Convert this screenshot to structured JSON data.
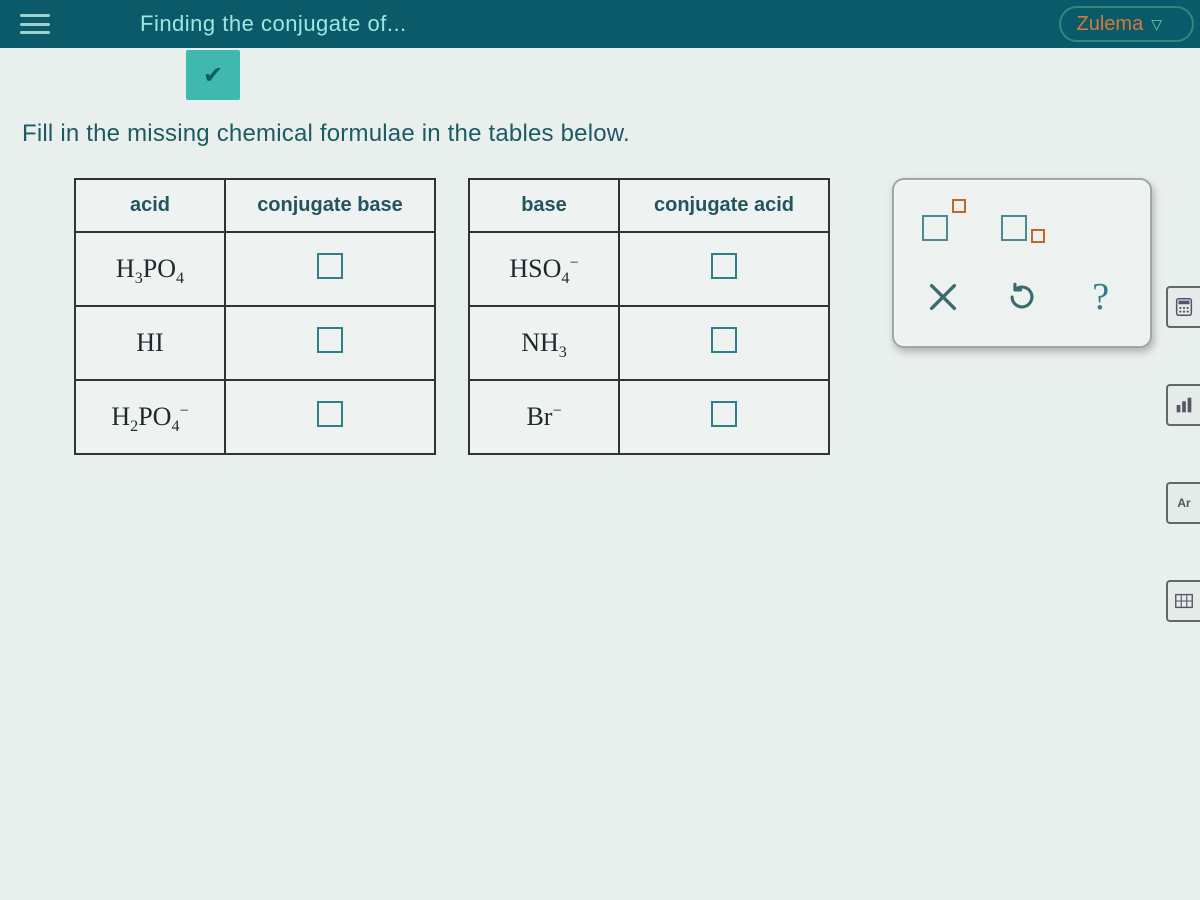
{
  "header": {
    "title": "Finding the conjugate of...",
    "user": "Zulema"
  },
  "instruction": "Fill in the missing chemical formulae in the tables below.",
  "table1": {
    "headers": [
      "acid",
      "conjugate base"
    ],
    "rows": [
      {
        "given_html": "H<sub>3</sub>PO<sub>4</sub>"
      },
      {
        "given_html": "HI"
      },
      {
        "given_html": "H<sub>2</sub>PO<sub>4</sub><sup>−</sup>"
      }
    ]
  },
  "table2": {
    "headers": [
      "base",
      "conjugate acid"
    ],
    "rows": [
      {
        "given_html": "HSO<sub>4</sub><sup>−</sup>"
      },
      {
        "given_html": "NH<sub>3</sub>"
      },
      {
        "given_html": "Br<sup>−</sup>"
      }
    ]
  },
  "palette": {
    "tools_row1": [
      "superscript",
      "subscript"
    ],
    "tools_row2": [
      "clear",
      "reset",
      "help"
    ]
  },
  "edge_tools": [
    "calculator",
    "bar-chart",
    "argon",
    "periodic-table"
  ]
}
